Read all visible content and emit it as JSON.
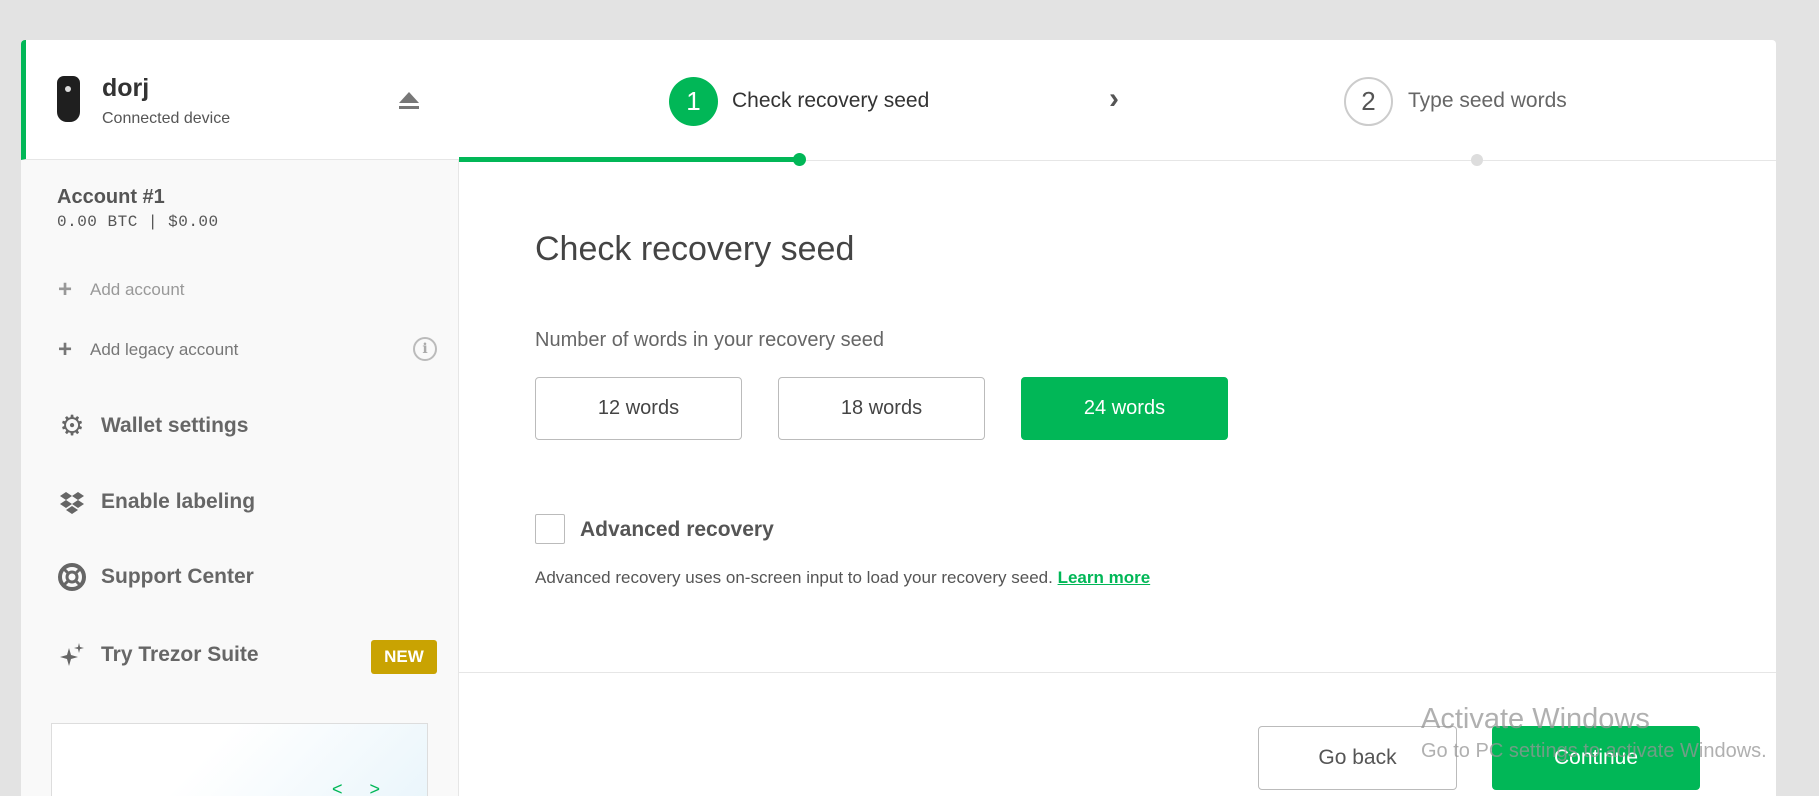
{
  "device": {
    "name": "dorj",
    "status": "Connected device",
    "icon": "trezor-device-icon"
  },
  "account": {
    "name": "Account #1",
    "balance": "0.00 BTC | $0.00"
  },
  "sidebar": {
    "add_account": "Add account",
    "add_legacy_account": "Add legacy account",
    "menu": [
      {
        "label": "Wallet settings",
        "icon": "gear-icon"
      },
      {
        "label": "Enable labeling",
        "icon": "dropbox-icon"
      },
      {
        "label": "Support Center",
        "icon": "lifebuoy-icon"
      },
      {
        "label": "Try Trezor Suite",
        "icon": "sparkle-icon"
      }
    ],
    "new_badge": "NEW",
    "promo_prev": "<",
    "promo_next": ">"
  },
  "stepper": {
    "step1_number": "1",
    "step1_label": "Check recovery seed",
    "step2_number": "2",
    "step2_label": "Type seed words"
  },
  "main": {
    "title": "Check recovery seed",
    "words_label": "Number of words in your recovery seed",
    "word_options": [
      "12 words",
      "18 words",
      "24 words"
    ],
    "selected_option": "24 words",
    "advanced_label": "Advanced recovery",
    "advanced_desc": "Advanced recovery uses on-screen input to load your recovery seed.",
    "learn_more": "Learn more",
    "go_back": "Go back",
    "continue": "Continue"
  },
  "watermark": {
    "title": "Activate Windows",
    "subtitle": "Go to PC settings to activate Windows."
  },
  "colors": {
    "accent": "#01b757",
    "badge": "#c9a302"
  }
}
